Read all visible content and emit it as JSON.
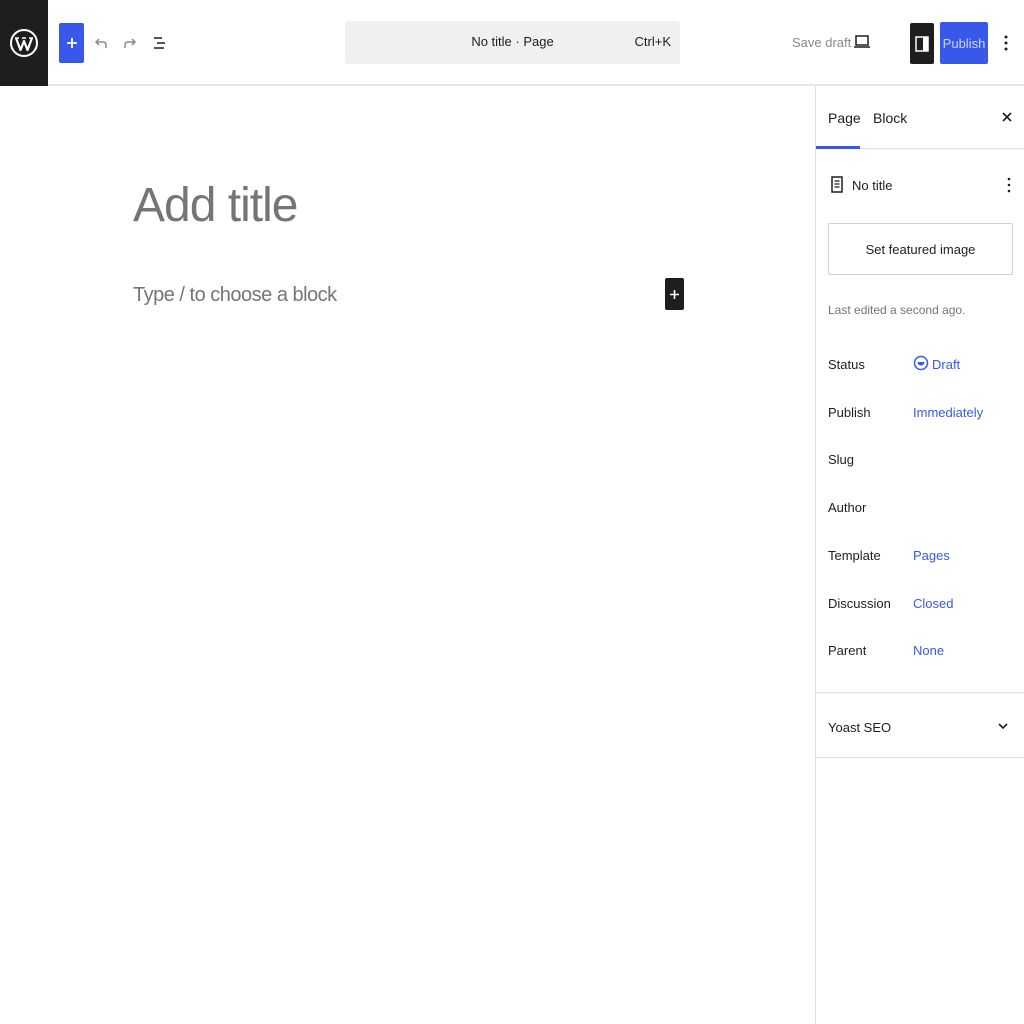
{
  "header": {
    "command_title": "No title · Page",
    "command_shortcut": "Ctrl+K",
    "save_draft_label": "Save draft",
    "publish_label": "Publish",
    "icons": [
      "wordpress-logo-icon",
      "plus-icon",
      "undo-icon",
      "redo-icon",
      "document-overview-icon",
      "preview-desktop-icon",
      "sidebar-toggle-icon",
      "more-options-icon"
    ],
    "accent_color": "#3858e9"
  },
  "editor": {
    "title_placeholder": "Add title",
    "block_placeholder": "Type / to choose a block"
  },
  "sidebar": {
    "tabs": [
      {
        "label": "Page",
        "active": true
      },
      {
        "label": "Block",
        "active": false
      }
    ],
    "document": {
      "title": "No title",
      "featured_image_button": "Set featured image",
      "last_edited": "Last edited a second ago."
    },
    "meta": {
      "status": {
        "label": "Status",
        "value": "Draft"
      },
      "publish": {
        "label": "Publish",
        "value": "Immediately"
      },
      "slug": {
        "label": "Slug",
        "value": ""
      },
      "author": {
        "label": "Author",
        "value": ""
      },
      "template": {
        "label": "Template",
        "value": "Pages"
      },
      "discussion": {
        "label": "Discussion",
        "value": "Closed"
      },
      "parent": {
        "label": "Parent",
        "value": "None"
      }
    },
    "panels": [
      {
        "label": "Yoast SEO",
        "expanded": false
      }
    ]
  }
}
